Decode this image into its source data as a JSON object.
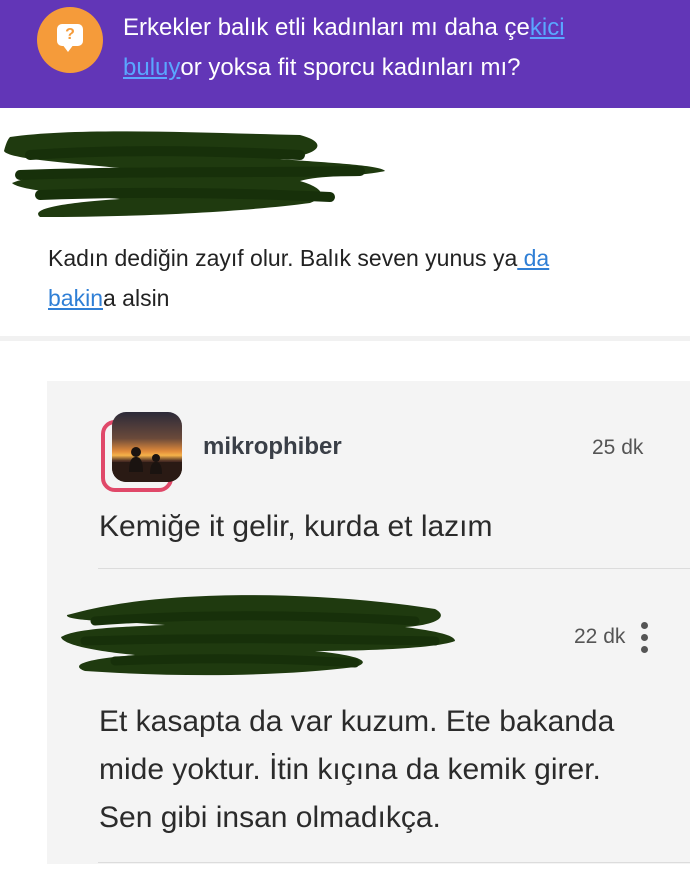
{
  "question": {
    "icon": "question-bubble-icon",
    "title_part1": "Erkekler balık etli kadınları mı daha çe",
    "title_link1": "kici",
    "title_break": " ",
    "title_link2": "buluy",
    "title_part2": "or yoksa fit sporcu kadınları mı?"
  },
  "answer": {
    "text_part1": "Kadın dediğin zayıf olur. Balık seven yunus ya",
    "link1": " da",
    "text_space": " ",
    "link2": "bakin",
    "text_part2": "a alsin"
  },
  "comments": [
    {
      "username": "mikrophiber",
      "time": "25 dk",
      "text": "Kemiğe it gelir, kurda et lazım"
    },
    {
      "time": "22 dk",
      "text_line1": "Et kasapta da var kuzum. Ete bakanda",
      "text_line2": "mide yoktur. İtin kıçına da kemik girer.",
      "text_line3": "Sen gibi insan olmadıkça."
    }
  ],
  "colors": {
    "header": "#6236b7",
    "badge": "#f59b3a",
    "link": "#3b8ef0",
    "avatar_ring": "#e04869",
    "redaction": "#1f3a0f"
  }
}
